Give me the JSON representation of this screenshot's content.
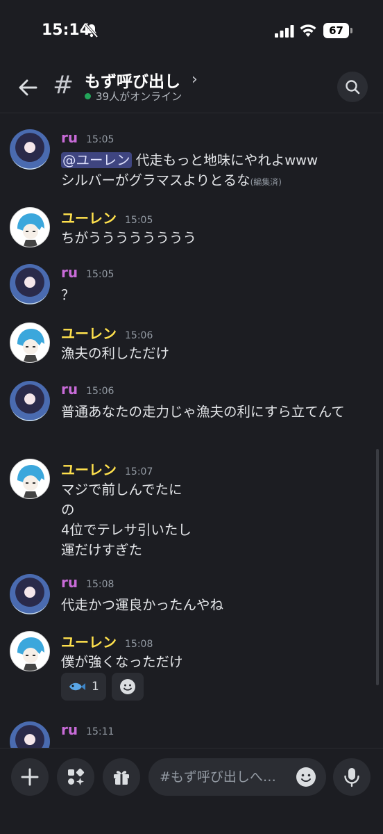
{
  "status_bar": {
    "time": "15:14",
    "battery": "67"
  },
  "header": {
    "channel": "もず呼び出し",
    "online": "39人がオンライン"
  },
  "messages": [
    {
      "author": "ru",
      "time": "15:05",
      "mention": "@ユーレン",
      "text": " 代走もっと地味にやれよwww",
      "text2": "シルバーがグラマスよりとるな",
      "edited": "(編集済)"
    },
    {
      "author": "ユーレン",
      "time": "15:05",
      "text": "ちがうううううううう"
    },
    {
      "author": "ru",
      "time": "15:05",
      "text": "？"
    },
    {
      "author": "ユーレン",
      "time": "15:06",
      "text": "漁夫の利しただけ"
    },
    {
      "author": "ru",
      "time": "15:06",
      "text": "普通あなたの走力じゃ漁夫の利にすら立てんて"
    },
    {
      "author": "ユーレン",
      "time": "15:07",
      "lines": [
        "マジで前しんでたに",
        "の",
        "4位でテレサ引いたし",
        "運だけすぎた"
      ]
    },
    {
      "author": "ru",
      "time": "15:08",
      "text": "代走かつ運良かったんやね"
    },
    {
      "author": "ユーレン",
      "time": "15:08",
      "text": "僕が強くなっただけ",
      "reaction_count": "1"
    },
    {
      "author": "ru",
      "time": "15:11"
    }
  ],
  "composer": {
    "placeholder": "#もず呼び出しへ…"
  },
  "icons": {
    "back": "arrow-left-icon",
    "search": "search-icon",
    "add": "plus-icon",
    "apps": "apps-icon",
    "gift": "gift-icon",
    "emoji": "emoji-icon",
    "mic": "microphone-icon"
  },
  "colors": {
    "ru": "#c86bd8",
    "eu": "#ffe14d",
    "online": "#23a55a",
    "mention_bg": "#3f4580"
  }
}
